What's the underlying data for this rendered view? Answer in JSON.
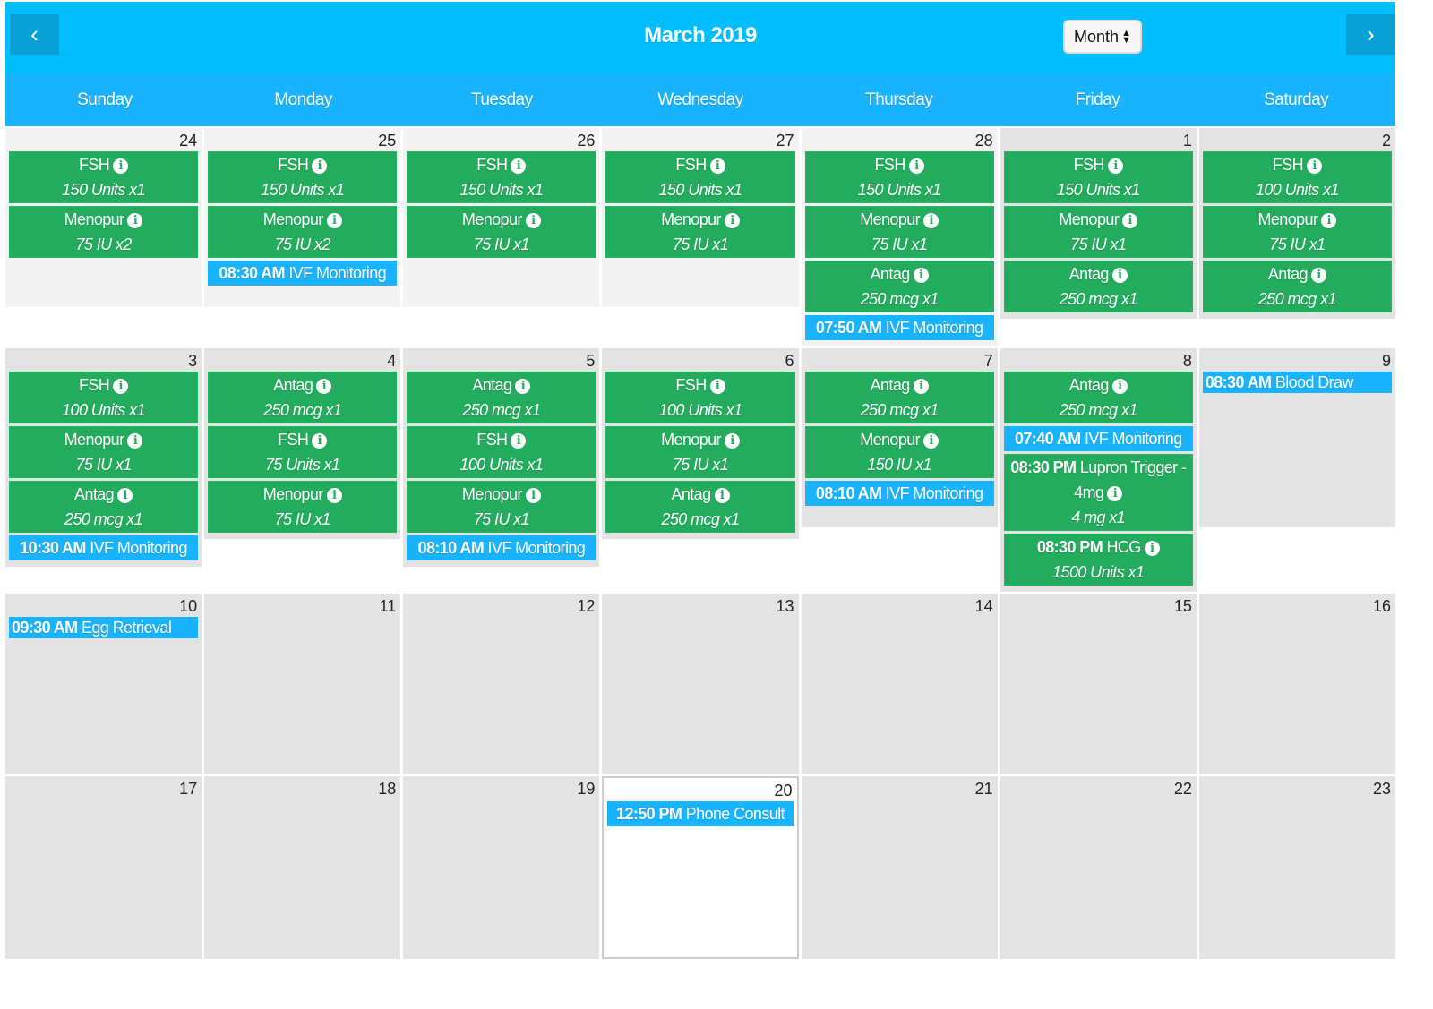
{
  "header": {
    "title": "March 2019",
    "view_select": "Month",
    "prev_icon": "chevron-left-icon",
    "next_icon": "chevron-right-icon"
  },
  "colors": {
    "header": "#03befe",
    "weekday_bar": "#1ab3fe",
    "medication": "#23ac5d",
    "appointment": "#1ab3fe"
  },
  "weekdays": [
    "Sunday",
    "Monday",
    "Tuesday",
    "Wednesday",
    "Thursday",
    "Friday",
    "Saturday"
  ],
  "weeks": [
    {
      "min_height": 200,
      "days": [
        {
          "day": "24",
          "shade": "light",
          "events": [
            {
              "type": "med",
              "name": "FSH",
              "dose": "150 Units x1"
            },
            {
              "type": "med",
              "name": "Menopur",
              "dose": "75 IU x2"
            }
          ]
        },
        {
          "day": "25",
          "shade": "light",
          "events": [
            {
              "type": "med",
              "name": "FSH",
              "dose": "150 Units x1"
            },
            {
              "type": "med",
              "name": "Menopur",
              "dose": "75 IU x2"
            },
            {
              "type": "appt",
              "time": "08:30 AM",
              "title": "IVF Monitoring"
            }
          ]
        },
        {
          "day": "26",
          "shade": "light",
          "events": [
            {
              "type": "med",
              "name": "FSH",
              "dose": "150 Units x1"
            },
            {
              "type": "med",
              "name": "Menopur",
              "dose": "75 IU x1"
            }
          ]
        },
        {
          "day": "27",
          "shade": "light",
          "events": [
            {
              "type": "med",
              "name": "FSH",
              "dose": "150 Units x1"
            },
            {
              "type": "med",
              "name": "Menopur",
              "dose": "75 IU x1"
            }
          ]
        },
        {
          "day": "28",
          "shade": "light",
          "events": [
            {
              "type": "med",
              "name": "FSH",
              "dose": "150 Units x1"
            },
            {
              "type": "med",
              "name": "Menopur",
              "dose": "75 IU x1"
            },
            {
              "type": "med",
              "name": "Antag",
              "dose": "250 mcg x1"
            },
            {
              "type": "appt",
              "time": "07:50 AM",
              "title": "IVF Monitoring"
            }
          ]
        },
        {
          "day": "1",
          "shade": "",
          "events": [
            {
              "type": "med",
              "name": "FSH",
              "dose": "150 Units x1"
            },
            {
              "type": "med",
              "name": "Menopur",
              "dose": "75 IU x1"
            },
            {
              "type": "med",
              "name": "Antag",
              "dose": "250 mcg x1"
            }
          ]
        },
        {
          "day": "2",
          "shade": "",
          "events": [
            {
              "type": "med",
              "name": "FSH",
              "dose": "100 Units x1"
            },
            {
              "type": "med",
              "name": "Menopur",
              "dose": "75 IU x1"
            },
            {
              "type": "med",
              "name": "Antag",
              "dose": "250 mcg x1"
            }
          ]
        }
      ]
    },
    {
      "min_height": 200,
      "days": [
        {
          "day": "3",
          "shade": "",
          "events": [
            {
              "type": "med",
              "name": "FSH",
              "dose": "100 Units x1"
            },
            {
              "type": "med",
              "name": "Menopur",
              "dose": "75 IU x1"
            },
            {
              "type": "med",
              "name": "Antag",
              "dose": "250 mcg x1"
            },
            {
              "type": "appt",
              "time": "10:30 AM",
              "title": "IVF Monitoring"
            }
          ]
        },
        {
          "day": "4",
          "shade": "",
          "events": [
            {
              "type": "med",
              "name": "Antag",
              "dose": "250 mcg x1"
            },
            {
              "type": "med",
              "name": "FSH",
              "dose": "75 Units x1"
            },
            {
              "type": "med",
              "name": "Menopur",
              "dose": "75 IU x1"
            }
          ]
        },
        {
          "day": "5",
          "shade": "",
          "events": [
            {
              "type": "med",
              "name": "Antag",
              "dose": "250 mcg x1"
            },
            {
              "type": "med",
              "name": "FSH",
              "dose": "100 Units x1"
            },
            {
              "type": "med",
              "name": "Menopur",
              "dose": "75 IU x1"
            },
            {
              "type": "appt",
              "time": "08:10 AM",
              "title": "IVF Monitoring"
            }
          ]
        },
        {
          "day": "6",
          "shade": "",
          "events": [
            {
              "type": "med",
              "name": "FSH",
              "dose": "100 Units x1"
            },
            {
              "type": "med",
              "name": "Menopur",
              "dose": "75 IU x1"
            },
            {
              "type": "med",
              "name": "Antag",
              "dose": "250 mcg x1"
            }
          ]
        },
        {
          "day": "7",
          "shade": "",
          "events": [
            {
              "type": "med",
              "name": "Antag",
              "dose": "250 mcg x1"
            },
            {
              "type": "med",
              "name": "Menopur",
              "dose": "150 IU x1"
            },
            {
              "type": "appt",
              "time": "08:10 AM",
              "title": "IVF Monitoring"
            }
          ]
        },
        {
          "day": "8",
          "shade": "",
          "events": [
            {
              "type": "med",
              "name": "Antag",
              "dose": "250 mcg x1"
            },
            {
              "type": "appt",
              "time": "07:40 AM",
              "title": "IVF Monitoring"
            },
            {
              "type": "med",
              "time": "08:30 PM",
              "name": "Lupron Trigger - 4mg",
              "dose": "4 mg x1"
            },
            {
              "type": "med",
              "time": "08:30 PM",
              "name": "HCG",
              "dose": "1500 Units x1"
            }
          ]
        },
        {
          "day": "9",
          "shade": "",
          "events": [
            {
              "type": "appt",
              "single": true,
              "time": "08:30 AM",
              "title": "Blood Draw"
            }
          ]
        }
      ]
    },
    {
      "min_height": 202,
      "days": [
        {
          "day": "10",
          "shade": "",
          "events": [
            {
              "type": "appt",
              "single": true,
              "time": "09:30 AM",
              "title": "Egg Retrieval"
            }
          ]
        },
        {
          "day": "11",
          "shade": "",
          "events": []
        },
        {
          "day": "12",
          "shade": "",
          "events": []
        },
        {
          "day": "13",
          "shade": "",
          "events": []
        },
        {
          "day": "14",
          "shade": "",
          "events": []
        },
        {
          "day": "15",
          "shade": "",
          "events": []
        },
        {
          "day": "16",
          "shade": "",
          "events": []
        }
      ]
    },
    {
      "min_height": 204,
      "days": [
        {
          "day": "17",
          "shade": "",
          "events": []
        },
        {
          "day": "18",
          "shade": "",
          "events": []
        },
        {
          "day": "19",
          "shade": "",
          "events": []
        },
        {
          "day": "20",
          "shade": "today",
          "events": [
            {
              "type": "appt",
              "time": "12:50 PM",
              "title": "Phone Consult"
            }
          ]
        },
        {
          "day": "21",
          "shade": "",
          "events": []
        },
        {
          "day": "22",
          "shade": "",
          "events": []
        },
        {
          "day": "23",
          "shade": "",
          "events": []
        }
      ]
    }
  ]
}
